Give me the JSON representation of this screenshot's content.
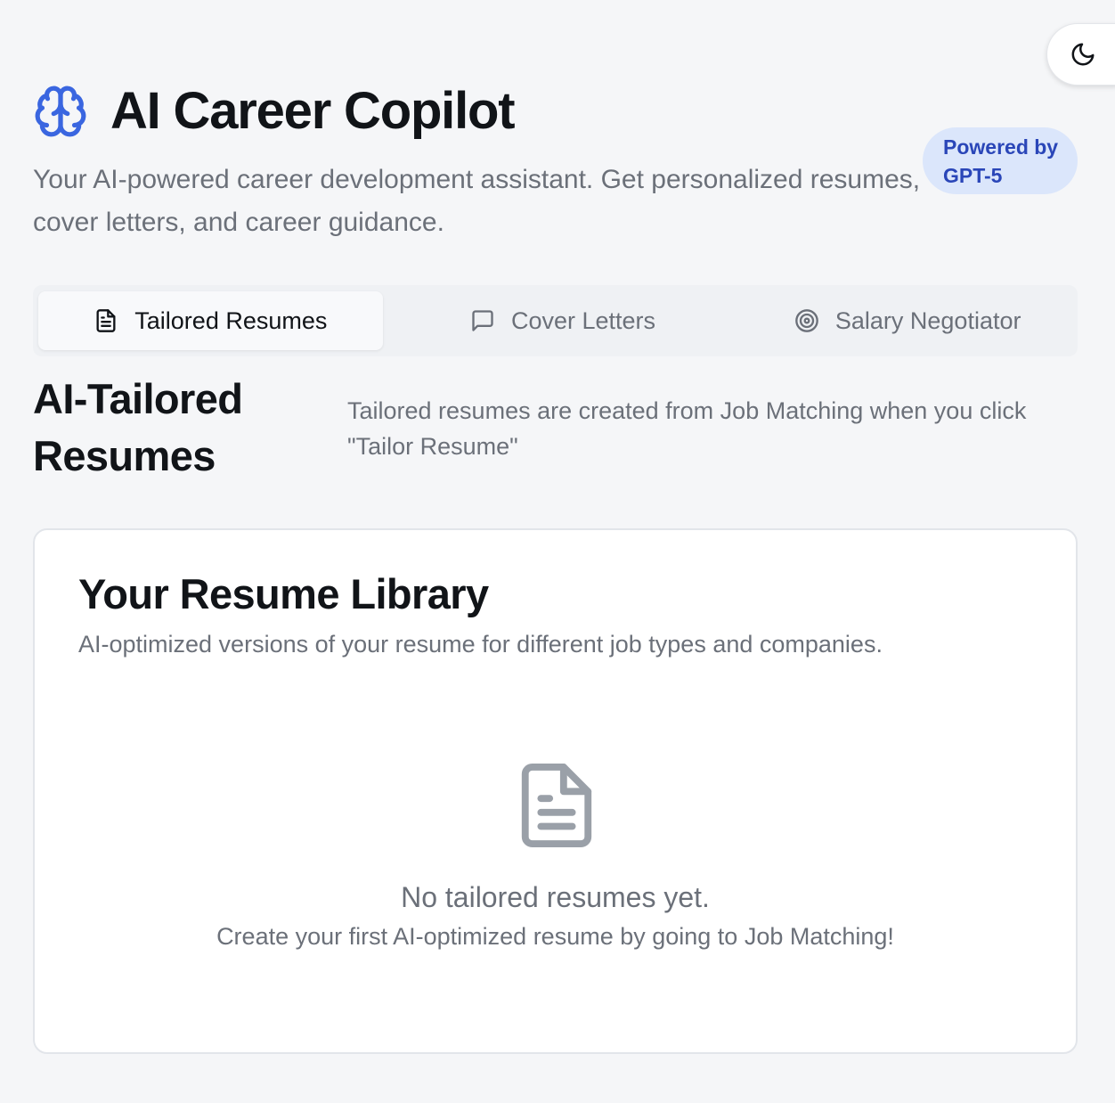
{
  "app": {
    "title": "AI Career Copilot",
    "subtitle": "Your AI-powered career development assistant. Get personalized resumes, cover letters, and career guidance.",
    "badge": "Powered by GPT-5",
    "logo_icon": "brain-icon",
    "theme_toggle_icon": "moon-icon"
  },
  "tabs": [
    {
      "label": "Tailored Resumes",
      "icon": "file-text-icon",
      "active": true
    },
    {
      "label": "Cover Letters",
      "icon": "message-square-icon",
      "active": false
    },
    {
      "label": "Salary Negotiator",
      "icon": "target-icon",
      "active": false
    }
  ],
  "section": {
    "title": "AI-Tailored Resumes",
    "note": "Tailored resumes are created from Job Matching when you click \"Tailor Resume\""
  },
  "library": {
    "title": "Your Resume Library",
    "description": "AI-optimized versions of your resume for different job types and companies.",
    "empty_icon": "file-text-icon",
    "empty_title": "No tailored resumes yet.",
    "empty_text": "Create your first AI-optimized resume by going to Job Matching!"
  },
  "colors": {
    "background": "#f5f6f8",
    "accent": "#3a66e0",
    "badge_bg": "#dbe6fb",
    "badge_text": "#2a46b8",
    "muted_text": "#6b7079"
  }
}
